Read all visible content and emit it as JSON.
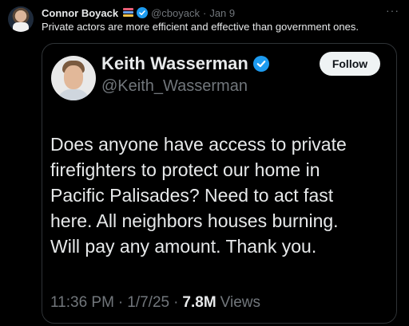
{
  "post": {
    "author_name": "Connor Boyack",
    "author_handle": "@cboyack",
    "separator": "·",
    "date": "Jan 9",
    "text": "Private actors are more efficient and effective than government ones.",
    "more_icon": "more-dots-icon",
    "books_colors": [
      "#e85d75",
      "#6aa0e8",
      "#f1c24c"
    ]
  },
  "quoted": {
    "author_name": "Keith Wasserman",
    "author_handle": "@Keith_Wasserman",
    "follow_label": "Follow",
    "body_lines": [
      "Does anyone have access to private",
      "firefighters to protect our home in",
      "Pacific Palisades? Need to act fast",
      "here. All neighbors houses burning.",
      "Will pay any amount. Thank you."
    ],
    "time": "11:36 PM",
    "dot1": "·",
    "date": "1/7/25",
    "dot2": "·",
    "views_count": "7.8M",
    "views_label": "Views"
  },
  "colors": {
    "verified": "#1d9bf0",
    "muted": "#71767b",
    "text": "#e7e9ea",
    "border": "#2f3336"
  }
}
